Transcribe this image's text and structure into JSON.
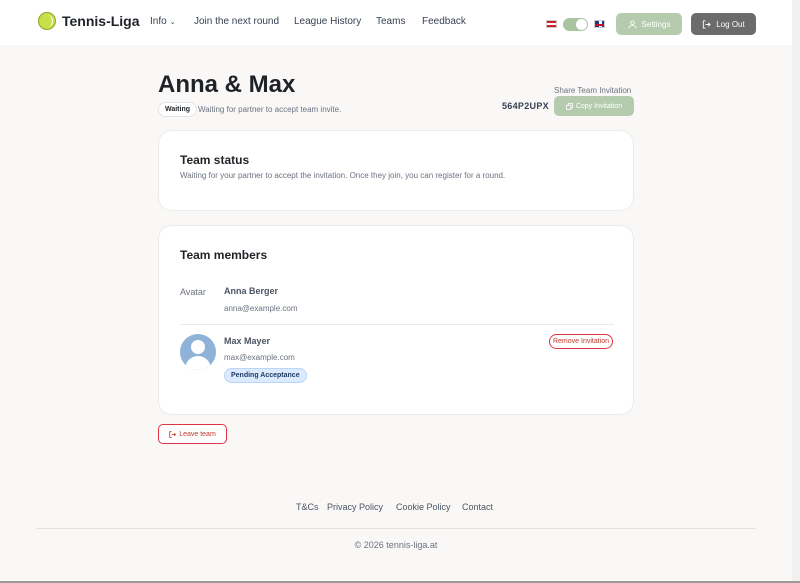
{
  "nav": {
    "logo_text": "Tennis-Liga",
    "links": [
      "Info",
      "Join the next round",
      "League History",
      "Teams",
      "Feedback"
    ],
    "settings_label": "Settings",
    "logout_label": "Log Out"
  },
  "team": {
    "name": "Anna & Max",
    "status_badge": "Waiting",
    "status_text": "Waiting for partner to accept team invite."
  },
  "invitation": {
    "share_label": "Share Team Invitation",
    "code": "564P2UPX",
    "copy_label": "Copy Invitation"
  },
  "status_card": {
    "heading": "Team status",
    "text": "Waiting for your partner to accept the invitation. Once they join, you can register for a round."
  },
  "members_card": {
    "heading": "Team members",
    "members": [
      {
        "avatar_alt": "Avatar",
        "name": "Anna Berger",
        "email": "anna@example.com"
      },
      {
        "name": "Max Mayer",
        "email": "max@example.com",
        "badge": "Pending Acceptance",
        "action": "Remove Invitation"
      }
    ]
  },
  "leave_label": "Leave team",
  "footer": {
    "links": [
      "T&Cs",
      "Privacy Policy",
      "Cookie Policy",
      "Contact"
    ],
    "copyright": "© 2026 tennis-liga.at"
  },
  "colors": {
    "accent_green": "#b4ccad",
    "danger": "#dc3545",
    "logout_gray": "#6b6b6b"
  }
}
